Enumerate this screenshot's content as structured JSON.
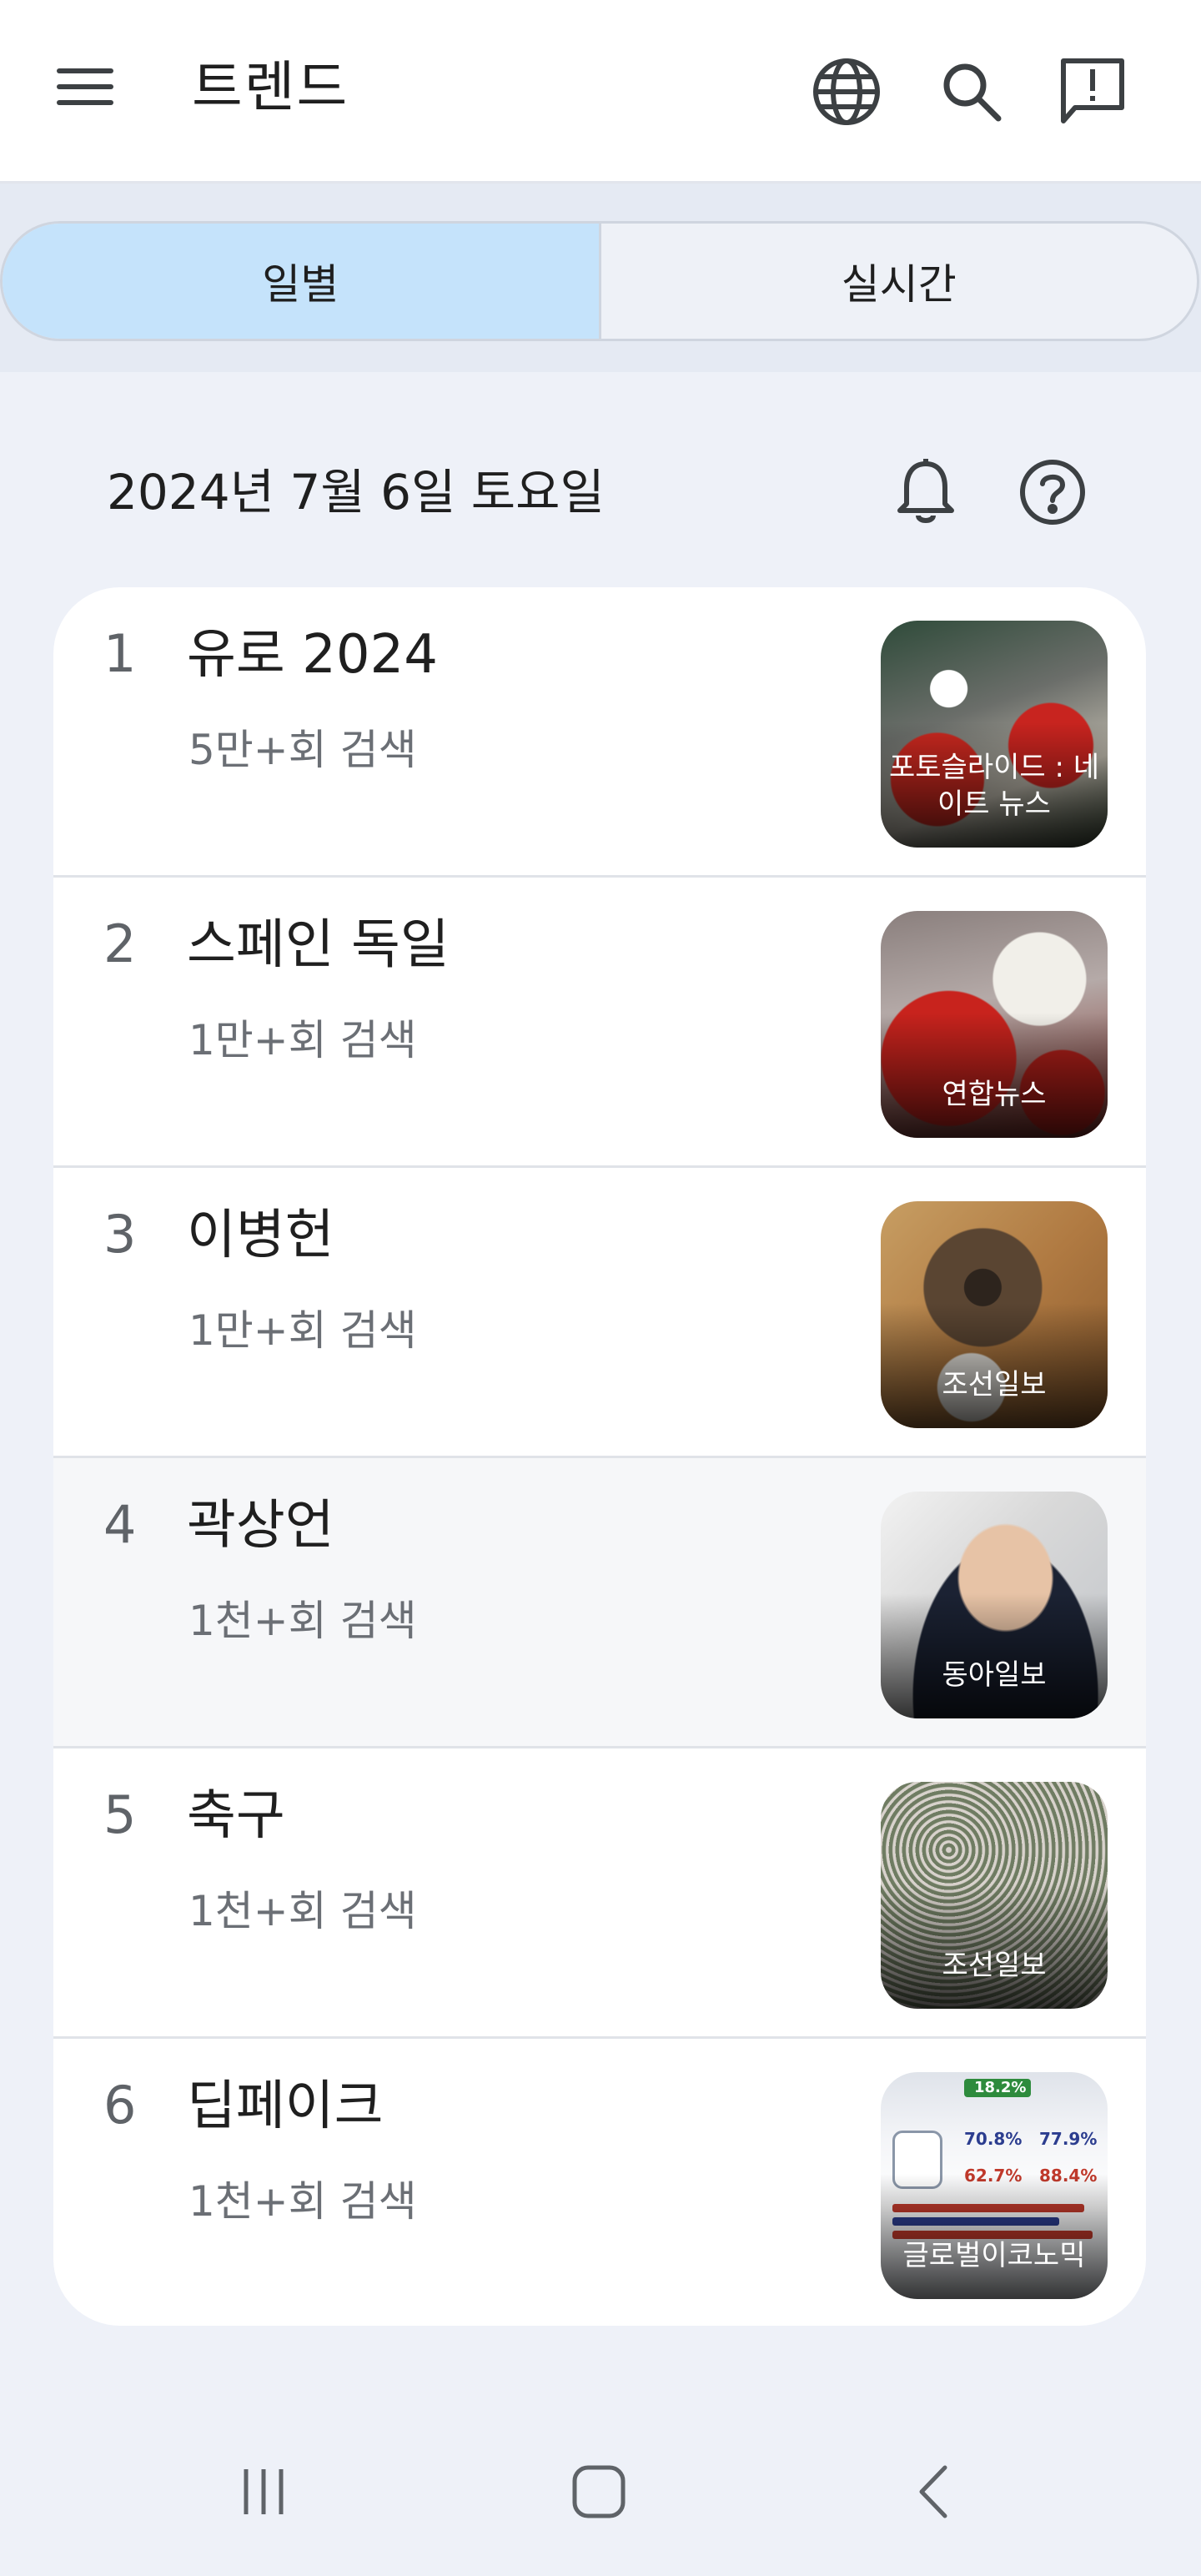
{
  "app_bar": {
    "title": "트렌드",
    "icons": [
      "hamburger-menu-icon",
      "globe-icon",
      "search-icon",
      "feedback-icon"
    ]
  },
  "tabs": [
    {
      "label": "일별",
      "active": true
    },
    {
      "label": "실시간",
      "active": false
    }
  ],
  "date_header": {
    "date": "2024년 7월 6일 토요일",
    "icons": [
      "bell-icon",
      "help-icon"
    ]
  },
  "trends": [
    {
      "rank": "1",
      "term": "유로 2024",
      "count": "5만+회 검색",
      "source": "포토슬라이드 : 네이트 뉴스"
    },
    {
      "rank": "2",
      "term": "스페인 독일",
      "count": "1만+회 검색",
      "source": "연합뉴스"
    },
    {
      "rank": "3",
      "term": "이병헌",
      "count": "1만+회 검색",
      "source": "조선일보"
    },
    {
      "rank": "4",
      "term": "곽상언",
      "count": "1천+회 검색",
      "source": "동아일보"
    },
    {
      "rank": "5",
      "term": "축구",
      "count": "1천+회 검색",
      "source": "조선일보"
    },
    {
      "rank": "6",
      "term": "딥페이크",
      "count": "1천+회 검색",
      "source": "글로벌이코노믹"
    }
  ],
  "thumb6_stats": [
    "18.2%",
    "70.8%",
    "77.9%",
    "62.7%",
    "88.4%"
  ],
  "colors": {
    "active_tab": "#c5e3fb",
    "background": "#eef1f8",
    "card": "#ffffff"
  },
  "nav_bar": {
    "icons": [
      "recent-apps-icon",
      "home-icon",
      "back-icon"
    ]
  }
}
